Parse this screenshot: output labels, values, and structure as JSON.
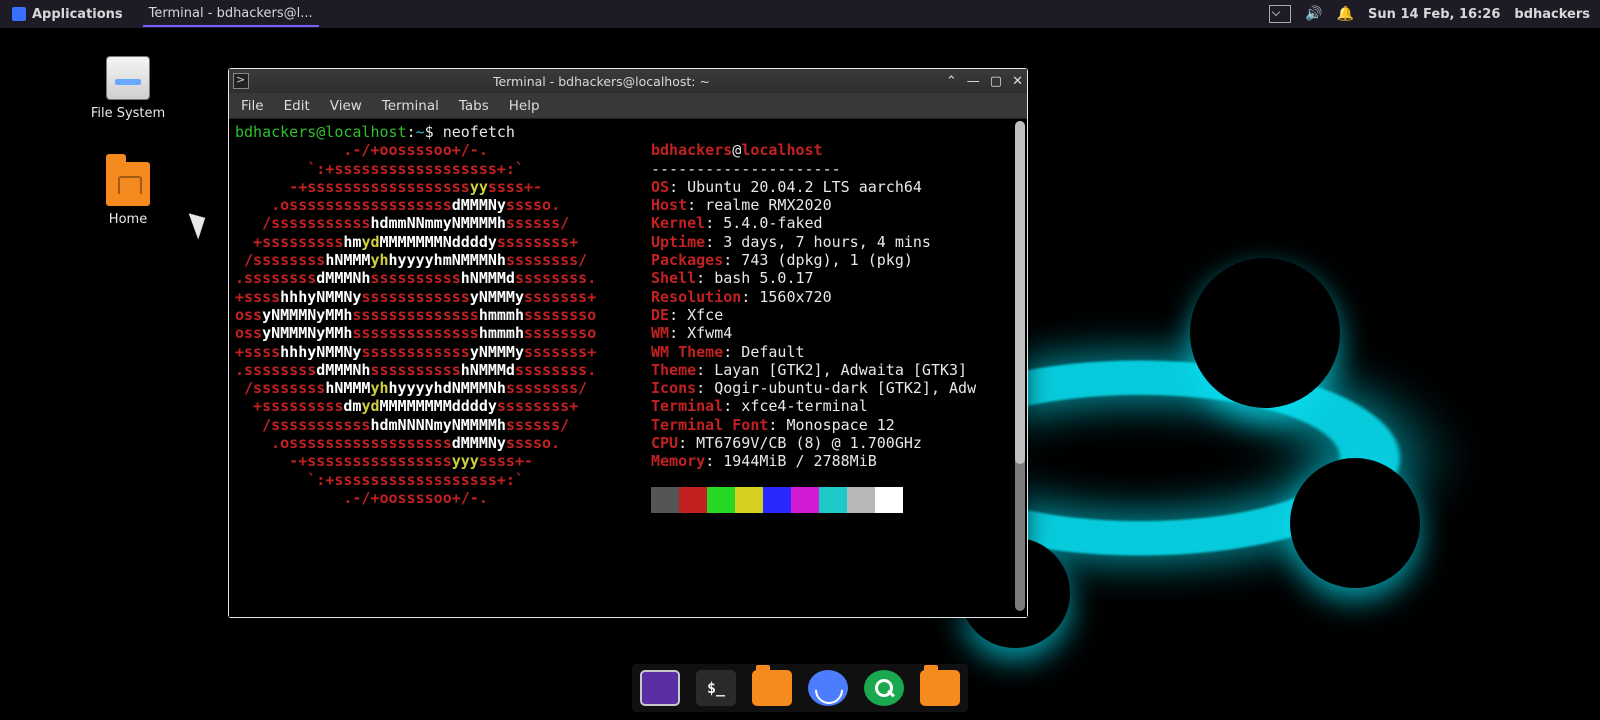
{
  "panel": {
    "applications_label": "Applications",
    "task_title": "Terminal - bdhackers@l...",
    "clock": "Sun 14 Feb, 16:26",
    "user": "bdhackers"
  },
  "desktop_icons": {
    "filesystem": "File System",
    "home": "Home"
  },
  "terminal": {
    "title": "Terminal - bdhackers@localhost: ~",
    "menus": [
      "File",
      "Edit",
      "View",
      "Terminal",
      "Tabs",
      "Help"
    ],
    "prompt_user": "bdhackers@localhost",
    "prompt_sep": ":",
    "prompt_path": "~",
    "prompt_sym": "$ ",
    "command": "neofetch",
    "neofetch_header_user": "bdhackers",
    "neofetch_header_at": "@",
    "neofetch_header_host": "localhost",
    "dashline": "---------------------",
    "info": {
      "OS": "Ubuntu 20.04.2 LTS aarch64",
      "Host": "realme RMX2020",
      "Kernel": "5.4.0-faked",
      "Uptime": "3 days, 7 hours, 4 mins",
      "Packages": "743 (dpkg), 1 (pkg)",
      "Shell": "bash 5.0.17",
      "Resolution": "1560x720",
      "DE": "Xfce",
      "WM": "Xfwm4",
      "WM Theme": "Default",
      "Theme": "Layan [GTK2], Adwaita [GTK3]",
      "Icons": "Qogir-ubuntu-dark [GTK2], Adw",
      "Terminal": "xfce4-terminal",
      "Terminal Font": "Monospace 12",
      "CPU": "MT6769V/CB (8) @ 1.700GHz",
      "Memory": "1944MiB / 2788MiB"
    },
    "info_order": [
      "OS",
      "Host",
      "Kernel",
      "Uptime",
      "Packages",
      "Shell",
      "Resolution",
      "DE",
      "WM",
      "WM Theme",
      "Theme",
      "Icons",
      "Terminal",
      "Terminal Font",
      "CPU",
      "Memory"
    ],
    "palette": [
      "#555555",
      "#c22121",
      "#26d726",
      "#d6d020",
      "#2929ff",
      "#d21bd2",
      "#1cc9c9",
      "#b8b8b8",
      "#ffffff"
    ],
    "ascii": [
      [
        [
          "r",
          "            .-/+oossssoo+/-.            "
        ]
      ],
      [
        [
          "r",
          "        `:+ssssssssssssssssss+:`        "
        ]
      ],
      [
        [
          "r",
          "      -+ssssssssssssssssss"
        ],
        [
          "y",
          "yy"
        ],
        [
          "r",
          "ssss+-      "
        ]
      ],
      [
        [
          "r",
          "    .ossssssssssssssssss"
        ],
        [
          "wh",
          "dMMMNy"
        ],
        [
          "r",
          "sssso.    "
        ]
      ],
      [
        [
          "r",
          "   /sssssssssss"
        ],
        [
          "wh",
          "hdmmNNmmyNMMMMh"
        ],
        [
          "r",
          "ssssss/   "
        ]
      ],
      [
        [
          "r",
          "  +sssssssss"
        ],
        [
          "wh",
          "hm"
        ],
        [
          "y",
          "yd"
        ],
        [
          "wh",
          "MMMMMMMNddddy"
        ],
        [
          "r",
          "ssssssss+  "
        ]
      ],
      [
        [
          "r",
          " /ssssssss"
        ],
        [
          "wh",
          "hNMMM"
        ],
        [
          "y",
          "yh"
        ],
        [
          "wh",
          "hyyyyhmNMMMNh"
        ],
        [
          "r",
          "ssssssss/ "
        ]
      ],
      [
        [
          "r",
          ".ssssssss"
        ],
        [
          "wh",
          "dMMMNh"
        ],
        [
          "r",
          "ssssssssss"
        ],
        [
          "wh",
          "hNMMMd"
        ],
        [
          "r",
          "ssssssss."
        ]
      ],
      [
        [
          "r",
          "+ssss"
        ],
        [
          "wh",
          "hhhyNMMNy"
        ],
        [
          "r",
          "ssssssssssss"
        ],
        [
          "wh",
          "yNMMMy"
        ],
        [
          "r",
          "sssssss+"
        ]
      ],
      [
        [
          "r",
          "oss"
        ],
        [
          "wh",
          "yNMMMNyMMh"
        ],
        [
          "r",
          "ssssssssssssss"
        ],
        [
          "wh",
          "hmmmh"
        ],
        [
          "r",
          "ssssssso"
        ]
      ],
      [
        [
          "r",
          "oss"
        ],
        [
          "wh",
          "yNMMMNyMMh"
        ],
        [
          "r",
          "ssssssssssssss"
        ],
        [
          "wh",
          "hmmmh"
        ],
        [
          "r",
          "ssssssso"
        ]
      ],
      [
        [
          "r",
          "+ssss"
        ],
        [
          "wh",
          "hhhyNMMNy"
        ],
        [
          "r",
          "ssssssssssss"
        ],
        [
          "wh",
          "yNMMMy"
        ],
        [
          "r",
          "sssssss+"
        ]
      ],
      [
        [
          "r",
          ".ssssssss"
        ],
        [
          "wh",
          "dMMMNh"
        ],
        [
          "r",
          "ssssssssss"
        ],
        [
          "wh",
          "hNMMMd"
        ],
        [
          "r",
          "ssssssss."
        ]
      ],
      [
        [
          "r",
          " /ssssssss"
        ],
        [
          "wh",
          "hNMMM"
        ],
        [
          "y",
          "yh"
        ],
        [
          "wh",
          "hyyyyhdNMMMNh"
        ],
        [
          "r",
          "ssssssss/ "
        ]
      ],
      [
        [
          "r",
          "  +sssssssss"
        ],
        [
          "wh",
          "dm"
        ],
        [
          "y",
          "yd"
        ],
        [
          "wh",
          "MMMMMMMMddddy"
        ],
        [
          "r",
          "ssssssss+  "
        ]
      ],
      [
        [
          "r",
          "   /sssssssssss"
        ],
        [
          "wh",
          "hdmNNNNmyNMMMMh"
        ],
        [
          "r",
          "ssssss/   "
        ]
      ],
      [
        [
          "r",
          "    .ossssssssssssssssss"
        ],
        [
          "wh",
          "dMMMNy"
        ],
        [
          "r",
          "sssso.    "
        ]
      ],
      [
        [
          "r",
          "      -+ssssssssssssssss"
        ],
        [
          "y",
          "yyy"
        ],
        [
          "r",
          "ssss+-      "
        ]
      ],
      [
        [
          "r",
          "        `:+ssssssssssssssssss+:`        "
        ]
      ],
      [
        [
          "r",
          "            .-/+oossssoo+/-.            "
        ]
      ]
    ]
  },
  "dock_items": [
    "show-desktop",
    "terminal",
    "file-manager",
    "web-browser",
    "app-finder",
    "files"
  ]
}
